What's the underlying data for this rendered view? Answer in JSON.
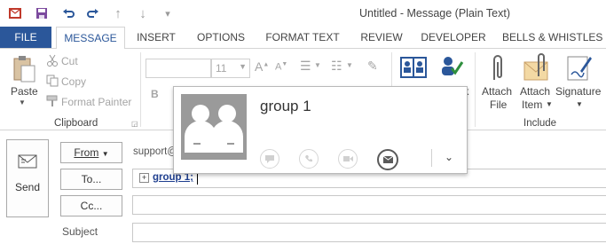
{
  "window": {
    "title": "Untitled - Message (Plain Text)"
  },
  "tabs": [
    {
      "label": "FILE"
    },
    {
      "label": "MESSAGE"
    },
    {
      "label": "INSERT"
    },
    {
      "label": "OPTIONS"
    },
    {
      "label": "FORMAT TEXT"
    },
    {
      "label": "REVIEW"
    },
    {
      "label": "DEVELOPER"
    },
    {
      "label": "BELLS & WHISTLES"
    }
  ],
  "clipboard": {
    "paste": "Paste",
    "cut": "Cut",
    "copy": "Copy",
    "format_painter": "Format Painter",
    "group_label": "Clipboard"
  },
  "basic_text": {
    "font_size": "11",
    "bold": "B"
  },
  "include": {
    "attach_file_1": "Attach",
    "attach_file_2": "File",
    "attach_item_1": "Attach",
    "attach_item_2": "Item",
    "signature": "Signature",
    "group_label": "Include"
  },
  "compose": {
    "send": "Send",
    "from": "From",
    "from_value": "support@",
    "to": "To...",
    "cc": "Cc...",
    "subject": "Subject",
    "to_recipient": "group 1;"
  },
  "contact_card": {
    "name": "group 1"
  },
  "colors": {
    "accent": "#2b579a",
    "file_tab": "#2b579a"
  }
}
